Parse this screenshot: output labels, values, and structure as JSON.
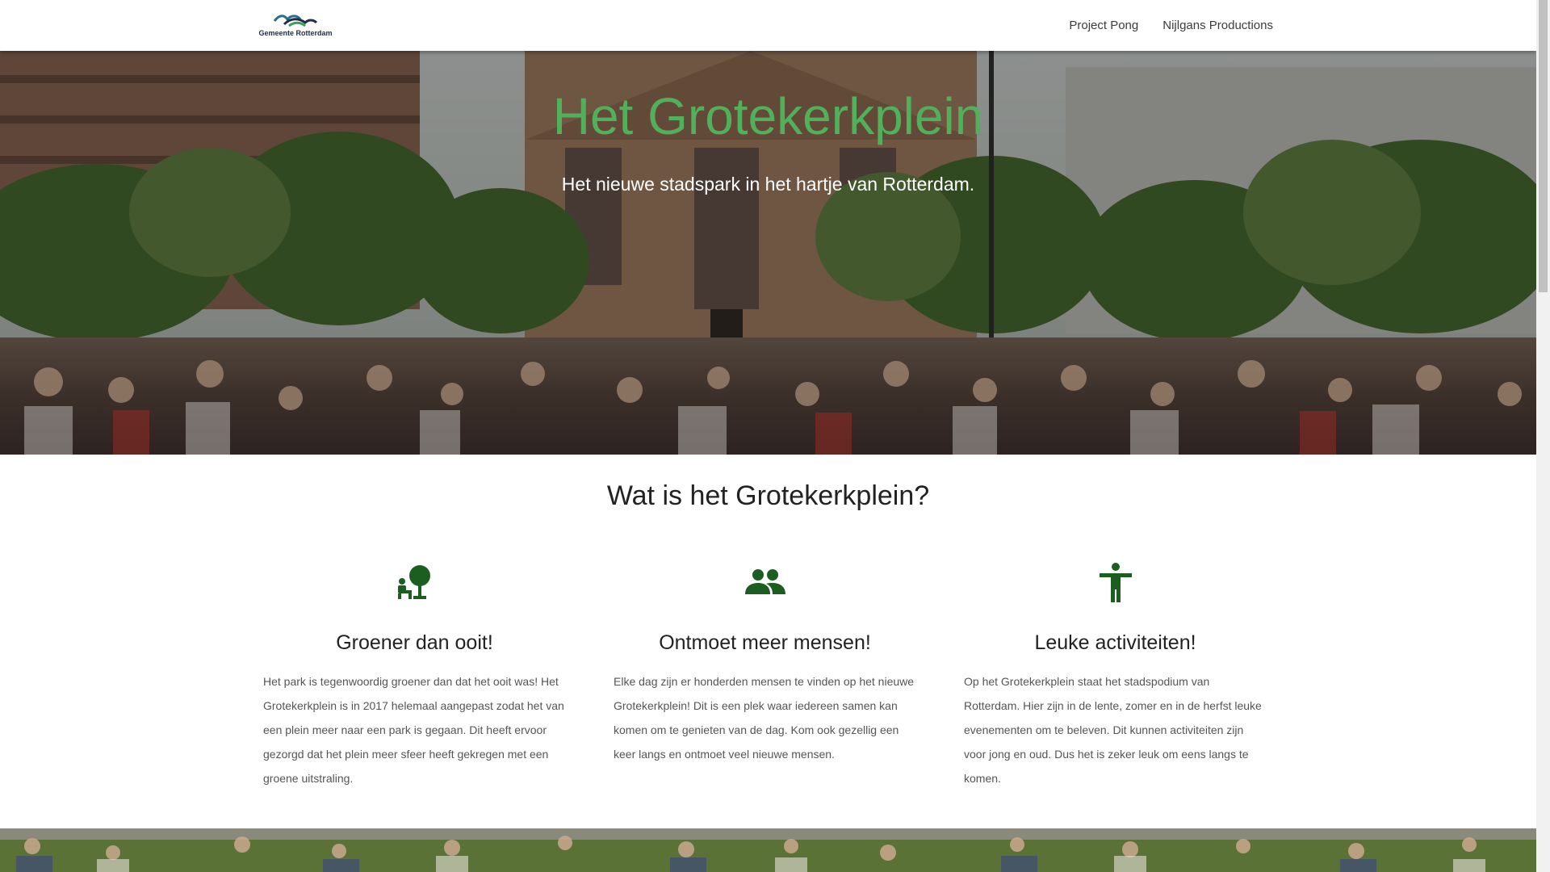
{
  "navbar": {
    "logo_text": "Gemeente Rotterdam",
    "links": [
      {
        "label": "Project Pong"
      },
      {
        "label": "Nijlgans Productions"
      }
    ]
  },
  "hero": {
    "title": "Het Grotekerkplein",
    "subtitle": "Het nieuwe stadspark in het hartje van Rotterdam."
  },
  "section": {
    "title": "Wat is het Grotekerkplein?"
  },
  "features": [
    {
      "icon": "nature-people-icon",
      "title": "Groener dan ooit!",
      "text": "Het park is tegenwoordig groener dan dat het ooit was! Het Grotekerkplein is in 2017 helemaal aangepast zodat het van een plein meer naar een park is gegaan. Dit heeft ervoor gezorgd dat het plein meer sfeer heeft gekregen met een groene uitstraling."
    },
    {
      "icon": "people-icon",
      "title": "Ontmoet meer mensen!",
      "text": "Elke dag zijn er honderden mensen te vinden op het nieuwe Grotekerkplein! Dit is een plek waar iedereen samen kan komen om te genieten van de dag. Kom ook gezellig een keer langs en ontmoet veel nieuwe mensen."
    },
    {
      "icon": "accessibility-icon",
      "title": "Leuke activiteiten!",
      "text": "Op het Grotekerkplein staat het stadspodium van Rotterdam. Hier zijn in de lente, zomer en in de herfst leuke evenementen om te beleven. Dit kunnen activiteiten zijn voor jong en oud. Dus het is zeker leuk om eens langs te komen."
    }
  ],
  "colors": {
    "accent_green": "#52b05a",
    "icon_green": "#1b5e20"
  }
}
